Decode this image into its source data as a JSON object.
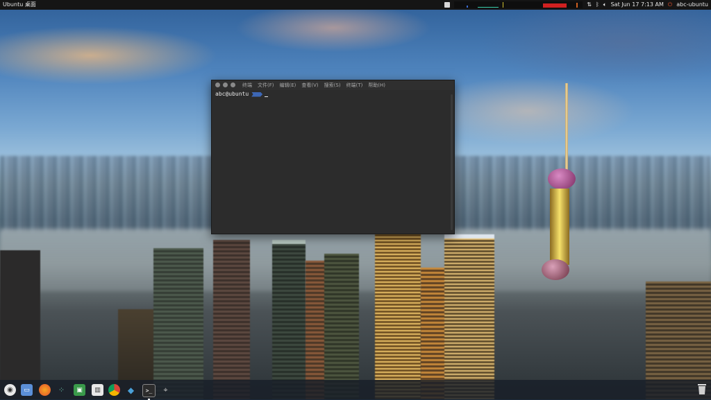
{
  "top_panel": {
    "title": "Ubuntu 桌面",
    "tray": {
      "network_icon": "network-updown-icon",
      "bluetooth_icon": "bluetooth-icon",
      "volume_icon": "volume-icon",
      "datetime": "Sat Jun 17 7:13 AM",
      "power_icon": "power-icon",
      "user": "abc-ubuntu"
    }
  },
  "terminal": {
    "menus": [
      "终端",
      "文件(F)",
      "编辑(E)",
      "查看(V)",
      "搜索(S)",
      "终端(T)",
      "帮助(H)"
    ],
    "prompt": "abc@ubuntu"
  },
  "dock": {
    "items": [
      {
        "name": "dash-home-icon"
      },
      {
        "name": "files-icon"
      },
      {
        "name": "firefox-icon"
      },
      {
        "name": "network-tool-icon"
      },
      {
        "name": "app-icon"
      },
      {
        "name": "system-monitor-icon"
      },
      {
        "name": "chrome-icon"
      },
      {
        "name": "mysql-workbench-icon"
      },
      {
        "name": "terminal-icon"
      },
      {
        "name": "settings-icon"
      }
    ],
    "trash_icon": "trash-icon"
  },
  "colors": {
    "panel": "#151515",
    "terminal_bg": "#2c2c2c",
    "prompt_accent": "#3d67b5",
    "power_icon": "#e2502c"
  }
}
